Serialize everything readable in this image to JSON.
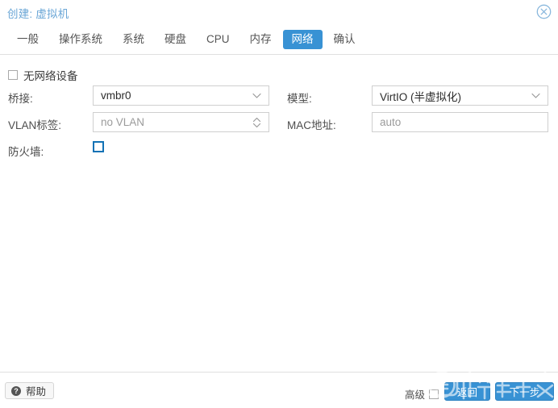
{
  "window": {
    "title": "创建: 虚拟机",
    "close_icon": "close-circle-icon"
  },
  "tabs": [
    {
      "label": "一般",
      "name": "tab-general",
      "active": false
    },
    {
      "label": "操作系统",
      "name": "tab-os",
      "active": false
    },
    {
      "label": "系统",
      "name": "tab-system",
      "active": false
    },
    {
      "label": "硬盘",
      "name": "tab-disks",
      "active": false
    },
    {
      "label": "CPU",
      "name": "tab-cpu",
      "active": false
    },
    {
      "label": "内存",
      "name": "tab-memory",
      "active": false
    },
    {
      "label": "网络",
      "name": "tab-network",
      "active": true
    },
    {
      "label": "确认",
      "name": "tab-confirm",
      "active": false
    }
  ],
  "form": {
    "no_network_device": {
      "label": "无网络设备",
      "checked": false
    },
    "bridge": {
      "label": "桥接:",
      "value": "vmbr0",
      "is_placeholder": false,
      "icon": "chevron-down-icon"
    },
    "vlan_tag": {
      "label": "VLAN标签:",
      "value": "no VLAN",
      "is_placeholder": true,
      "icon": "spinner-updown-icon"
    },
    "firewall": {
      "label": "防火墙:",
      "checked": false
    },
    "model": {
      "label": "模型:",
      "value": "VirtIO (半虚拟化)",
      "is_placeholder": false,
      "icon": "chevron-down-icon"
    },
    "mac_address": {
      "label": "MAC地址:",
      "value": "auto",
      "is_placeholder": true
    }
  },
  "footer": {
    "help_label": "帮助",
    "help_icon": "question-mark-icon",
    "advanced_label": "高级",
    "advanced_checked": false,
    "back_label": "返回",
    "next_label": "下一步"
  },
  "watermark": {
    "text": "什么值得买",
    "badge_text": "值"
  },
  "colors": {
    "accent": "#3892d4",
    "title_text": "#6aa6d6",
    "field_border": "#cfcfcf",
    "placeholder": "#9b9b9b",
    "checkbox_blue": "#1272b5"
  }
}
